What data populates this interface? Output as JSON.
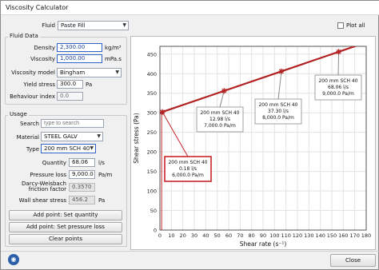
{
  "window": {
    "title": "Viscosity Calculator"
  },
  "fluid": {
    "label": "Fluid",
    "value": "Paste Fill",
    "plot_all_label": "Plot all"
  },
  "fluid_data": {
    "group_label": "Fluid Data",
    "density_label": "Density",
    "density_value": "2,300.00",
    "density_unit": "kg/m³",
    "viscosity_label": "Viscosity",
    "viscosity_value": "1,000.00",
    "viscosity_unit": "mPa.s",
    "model_label": "Viscosity model",
    "model_value": "Bingham",
    "yield_label": "Yield stress",
    "yield_value": "300.0",
    "yield_unit": "Pa",
    "behaviour_label": "Behaviour index",
    "behaviour_value": "0.0"
  },
  "usage": {
    "group_label": "Usage",
    "search_label": "Search",
    "search_placeholder": "type to search",
    "material_label": "Material",
    "material_value": "STEEL GALV",
    "type_label": "Type",
    "type_value": "200 mm SCH 40",
    "quantity_label": "Quantity",
    "quantity_value": "68.06",
    "quantity_unit": "l/s",
    "pressure_label": "Pressure loss",
    "pressure_value": "9,000.0",
    "pressure_unit": "Pa/m",
    "darcy_label_1": "Darcy-Weisbach",
    "darcy_label_2": "friction factor",
    "darcy_value": "0.3570",
    "wall_label": "Wall shear stress",
    "wall_value": "456.2",
    "wall_unit": "Pa"
  },
  "buttons": {
    "add_quantity": "Add point: Set quantity",
    "add_pressure": "Add point: Set pressure loss",
    "clear": "Clear points",
    "close": "Close"
  },
  "chart_data": {
    "type": "line",
    "title": "",
    "xlabel": "Shear rate (s⁻¹)",
    "ylabel": "Shear stress (Pa)",
    "xlim": [
      0,
      180
    ],
    "ylim": [
      0,
      470
    ],
    "xticks": [
      0,
      10,
      20,
      30,
      40,
      50,
      60,
      70,
      80,
      90,
      100,
      110,
      120,
      130,
      140,
      150,
      160,
      170,
      180
    ],
    "yticks": [
      0,
      50,
      100,
      150,
      200,
      250,
      300,
      350,
      400,
      450
    ],
    "grid": true,
    "series": [
      {
        "x": [
          0,
          180
        ],
        "y": [
          300,
          480
        ],
        "color": "#b22222"
      }
    ],
    "points": [
      {
        "x": 2.2,
        "y": 302,
        "label_lines": [
          "200 mm SCH 40",
          "0.18 l/s",
          "6,000.0 Pa/m"
        ],
        "highlight": true
      },
      {
        "x": 56,
        "y": 356,
        "label_lines": [
          "200 mm SCH 40",
          "12.98 l/s",
          "7,000.0 Pa/m"
        ],
        "highlight": false
      },
      {
        "x": 106,
        "y": 406,
        "label_lines": [
          "200 mm SCH 40",
          "37.30 l/s",
          "8,000.0 Pa/m"
        ],
        "highlight": false
      },
      {
        "x": 156,
        "y": 456,
        "label_lines": [
          "200 mm SCH 40",
          "68.06 l/s",
          "9,000.0 Pa/m"
        ],
        "highlight": false
      }
    ]
  }
}
